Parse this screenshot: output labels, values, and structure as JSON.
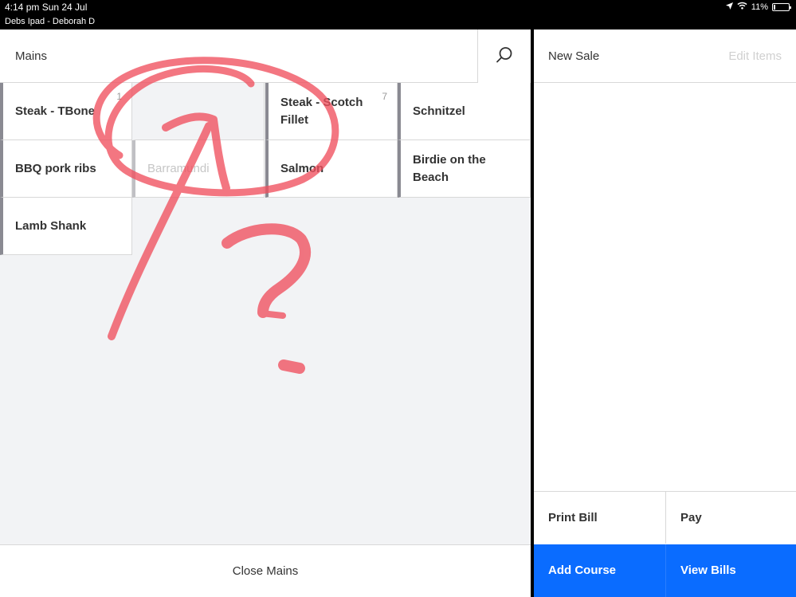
{
  "status_bar": {
    "time_date": "4:14 pm   Sun 24 Jul",
    "device": "Debs Ipad - Deborah D",
    "battery": "11%",
    "battery_level": 0.11
  },
  "left_panel": {
    "title": "Mains",
    "tiles": [
      {
        "label": "Steak - TBone",
        "count": "1"
      },
      {
        "label": "",
        "count": ""
      },
      {
        "label": "Steak - Scotch Fillet",
        "count": "7"
      },
      {
        "label": "Schnitzel",
        "count": ""
      },
      {
        "label": "BBQ pork ribs",
        "count": ""
      },
      {
        "label": "Barramundi",
        "count": ""
      },
      {
        "label": "Salmon",
        "count": ""
      },
      {
        "label": "Birdie on the Beach",
        "count": ""
      },
      {
        "label": "Lamb Shank",
        "count": ""
      }
    ],
    "close_label": "Close Mains"
  },
  "right_panel": {
    "title": "New Sale",
    "edit_label": "Edit Items",
    "print_bill": "Print Bill",
    "pay": "Pay",
    "add_course": "Add Course",
    "view_bills": "View Bills"
  },
  "colors": {
    "accent_blue": "#0a6cff",
    "annotation_red": "#f0505e"
  },
  "icons": {
    "search": "search-icon",
    "location": "location-arrow-icon",
    "wifi": "wifi-icon",
    "battery": "battery-icon"
  }
}
